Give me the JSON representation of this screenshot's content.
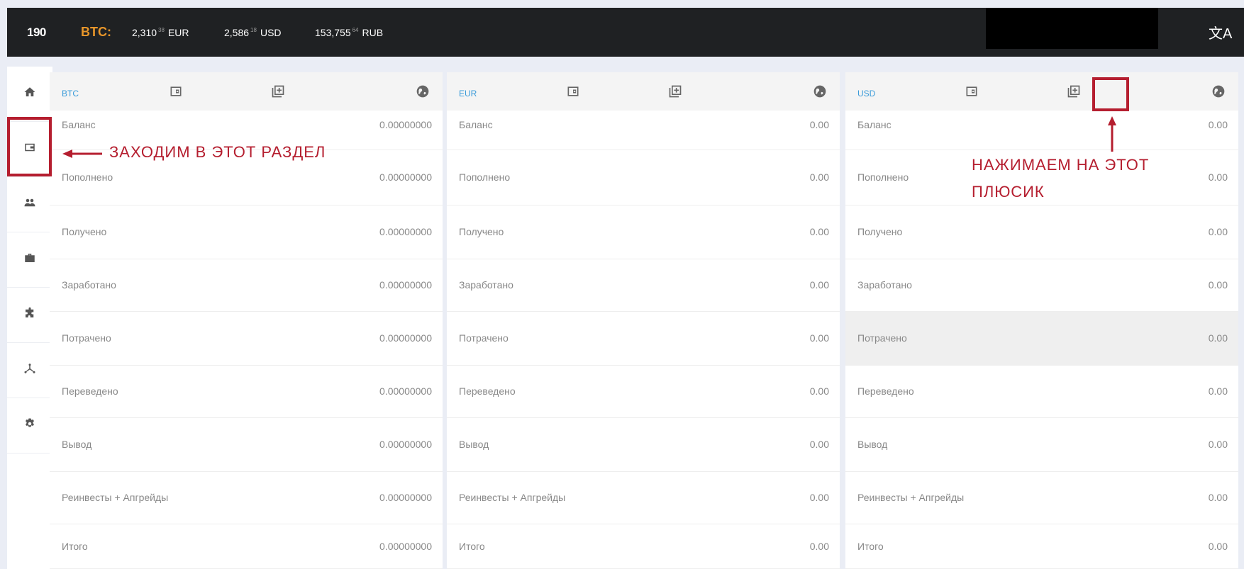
{
  "topbar": {
    "logo": "190",
    "btc_label": "BTC:",
    "prices": [
      {
        "main": "2,310",
        "frac": "38",
        "currency": "EUR"
      },
      {
        "main": "2,586",
        "frac": "18",
        "currency": "USD"
      },
      {
        "main": "153,755",
        "frac": "64",
        "currency": "RUB"
      }
    ],
    "lang_icon": "文A"
  },
  "sidebar": {
    "items": [
      {
        "name": "home",
        "icon": "home-icon"
      },
      {
        "name": "wallet",
        "icon": "wallet-icon"
      },
      {
        "name": "team",
        "icon": "people-icon"
      },
      {
        "name": "briefcase",
        "icon": "briefcase-icon"
      },
      {
        "name": "extensions",
        "icon": "puzzle-icon"
      },
      {
        "name": "network",
        "icon": "network-icon"
      },
      {
        "name": "settings",
        "icon": "gear-icon"
      }
    ]
  },
  "panels": [
    {
      "currency": "BTC",
      "rows": [
        {
          "label": "Баланс",
          "value": "0.00000000"
        },
        {
          "label": "Пополнено",
          "value": "0.00000000"
        },
        {
          "label": "Получено",
          "value": "0.00000000"
        },
        {
          "label": "Заработано",
          "value": "0.00000000"
        },
        {
          "label": "Потрачено",
          "value": "0.00000000"
        },
        {
          "label": "Переведено",
          "value": "0.00000000"
        },
        {
          "label": "Вывод",
          "value": "0.00000000"
        },
        {
          "label": "Реинвесты + Апгрейды",
          "value": "0.00000000"
        },
        {
          "label": "Итого",
          "value": "0.00000000"
        }
      ]
    },
    {
      "currency": "EUR",
      "rows": [
        {
          "label": "Баланс",
          "value": "0.00"
        },
        {
          "label": "Пополнено",
          "value": "0.00"
        },
        {
          "label": "Получено",
          "value": "0.00"
        },
        {
          "label": "Заработано",
          "value": "0.00"
        },
        {
          "label": "Потрачено",
          "value": "0.00"
        },
        {
          "label": "Переведено",
          "value": "0.00"
        },
        {
          "label": "Вывод",
          "value": "0.00"
        },
        {
          "label": "Реинвесты + Апгрейды",
          "value": "0.00"
        },
        {
          "label": "Итого",
          "value": "0.00"
        }
      ]
    },
    {
      "currency": "USD",
      "rows": [
        {
          "label": "Баланс",
          "value": "0.00"
        },
        {
          "label": "Пополнено",
          "value": "0.00"
        },
        {
          "label": "Получено",
          "value": "0.00"
        },
        {
          "label": "Заработано",
          "value": "0.00"
        },
        {
          "label": "Потрачено",
          "value": "0.00"
        },
        {
          "label": "Переведено",
          "value": "0.00"
        },
        {
          "label": "Вывод",
          "value": "0.00"
        },
        {
          "label": "Реинвесты + Апгрейды",
          "value": "0.00"
        },
        {
          "label": "Итого",
          "value": "0.00"
        }
      ]
    }
  ],
  "annotations": {
    "wallet_hint": "ЗАХОДИМ В ЭТОТ РАЗДЕЛ",
    "plus_hint_line1": "НАЖИМАЕМ НА ЭТОТ",
    "plus_hint_line2": "ПЛЮСИК",
    "color": "#b51e2f"
  },
  "colors": {
    "topbar_bg": "#1f2123",
    "btc_accent": "#e8962a",
    "currency_title": "#3a9bd9",
    "page_bg": "#eaedf5"
  }
}
